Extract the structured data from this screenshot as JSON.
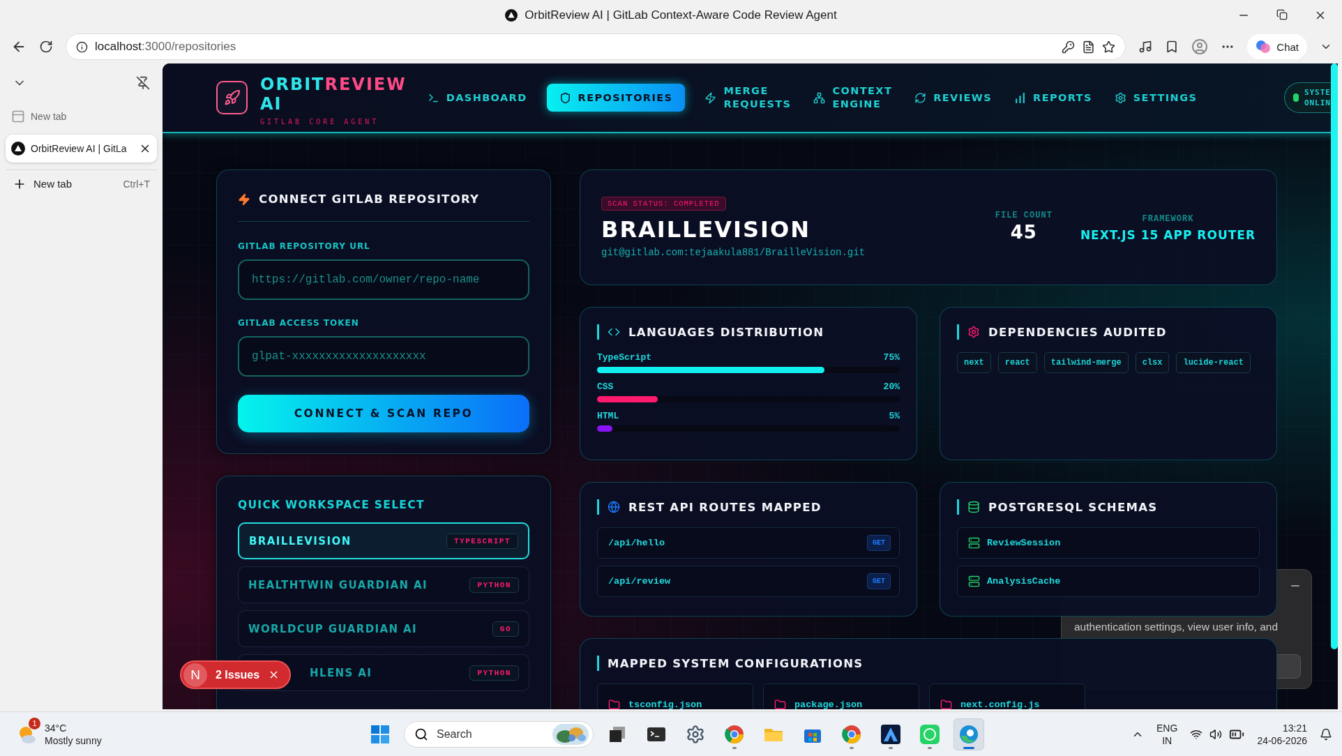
{
  "browser": {
    "window_title": "OrbitReview AI | GitLab Context-Aware Code Review Agent",
    "url_host": "localhost",
    "url_path": ":3000/repositories",
    "chat_label": "Chat"
  },
  "vertical_tabs": {
    "tabs": [
      {
        "title": "New tab",
        "selected": false
      },
      {
        "title": "OrbitReview AI | GitLa",
        "selected": true
      }
    ],
    "new_tab": {
      "label": "New tab",
      "shortcut": "Ctrl+T"
    }
  },
  "brand": {
    "name_words": [
      [
        {
          "text": "ORBIT",
          "color": "#2ee6ea"
        },
        {
          "text": "REVIEW",
          "color": "#ff4a86"
        }
      ],
      [
        {
          "text": "AI",
          "color": "#2ee6ea"
        }
      ]
    ],
    "subtitle": "GITLAB CORE AGENT"
  },
  "nav": [
    {
      "label": "DASHBOARD",
      "selected": false
    },
    {
      "label": "REPOSITORIES",
      "selected": true
    },
    {
      "label": "MERGE REQUESTS",
      "selected": false
    },
    {
      "label": "CONTEXT ENGINE",
      "selected": false
    },
    {
      "label": "REVIEWS",
      "selected": false
    },
    {
      "label": "REPORTS",
      "selected": false
    },
    {
      "label": "SETTINGS",
      "selected": false
    }
  ],
  "system_status": {
    "label": "SYSTE ONLIN",
    "online": true
  },
  "connect_card": {
    "title": "CONNECT GITLAB REPOSITORY",
    "fields": [
      {
        "label": "GITLAB REPOSITORY URL",
        "placeholder": "https://gitlab.com/owner/repo-name"
      },
      {
        "label": "GITLAB ACCESS TOKEN",
        "placeholder": "glpat-xxxxxxxxxxxxxxxxxxxx"
      }
    ],
    "button": "CONNECT & SCAN REPO"
  },
  "workspace_card": {
    "title": "QUICK WORKSPACE SELECT",
    "items": [
      {
        "name": "BRAILLEVISION",
        "language": "TYPESCRIPT",
        "selected": true,
        "obscured": false
      },
      {
        "name": "HEALTHTWIN GUARDIAN AI",
        "language": "PYTHON",
        "selected": false,
        "obscured": false
      },
      {
        "name": "WORLDCUP GUARDIAN AI",
        "language": "GO",
        "selected": false,
        "obscured": false
      },
      {
        "name": "HLENS AI",
        "language": "PYTHON",
        "selected": false,
        "obscured": true
      }
    ]
  },
  "repo_summary": {
    "status": "SCAN STATUS: COMPLETED",
    "name": "BRAILLEVISION",
    "git_url": "git@gitlab.com:tejaakula881/BrailleVision.git",
    "stats": [
      {
        "label": "FILE COUNT",
        "value": "45",
        "kind": "number"
      },
      {
        "label": "FRAMEWORK",
        "value": "NEXT.JS 15 APP ROUTER",
        "kind": "text"
      }
    ]
  },
  "languages": {
    "title": "LANGUAGES DISTRIBUTION",
    "items": [
      {
        "name": "TypeScript",
        "percent": "75%",
        "level": 0.75,
        "color": "#12f0f0"
      },
      {
        "name": "CSS",
        "percent": "20%",
        "level": 0.2,
        "color": "#ff1a6e"
      },
      {
        "name": "HTML",
        "percent": "5%",
        "level": 0.05,
        "color": "#8a12f5"
      }
    ]
  },
  "dependencies": {
    "title": "DEPENDENCIES AUDITED",
    "items": [
      "next",
      "react",
      "tailwind-merge",
      "clsx",
      "lucide-react"
    ]
  },
  "api_routes": {
    "title": "REST API ROUTES MAPPED",
    "items": [
      {
        "path": "/api/hello",
        "method": "GET"
      },
      {
        "path": "/api/review",
        "method": "GET"
      }
    ]
  },
  "schemas": {
    "title": "POSTGRESQL SCHEMAS",
    "items": [
      "ReviewSession",
      "AnalysisCache"
    ]
  },
  "configs": {
    "title": "MAPPED SYSTEM CONFIGURATIONS",
    "items": [
      "tsconfig.json",
      "package.json",
      "next.config.js"
    ]
  },
  "popup": {
    "text": "authentication settings, view user info, and"
  },
  "issues_badge": {
    "letter": "N",
    "label": "2 Issues"
  },
  "taskbar": {
    "weather": {
      "temperature": "34°C",
      "condition": "Mostly sunny",
      "badge": "1"
    },
    "search": {
      "placeholder": "Search"
    },
    "apps": [
      {
        "kind": "start",
        "running": false,
        "selected": false
      },
      {
        "kind": "taskview",
        "running": false,
        "selected": false
      },
      {
        "kind": "terminal",
        "running": false,
        "selected": false
      },
      {
        "kind": "settings",
        "running": false,
        "selected": false
      },
      {
        "kind": "browser",
        "running": true,
        "selected": false
      },
      {
        "kind": "folder",
        "running": false,
        "selected": false
      },
      {
        "kind": "store",
        "running": false,
        "selected": false
      },
      {
        "kind": "browser2",
        "running": true,
        "selected": false
      },
      {
        "kind": "triangle",
        "running": true,
        "selected": false
      },
      {
        "kind": "chat",
        "running": true,
        "selected": false
      },
      {
        "kind": "edge",
        "running": true,
        "selected": true
      }
    ],
    "language": [
      "ENG",
      "IN"
    ],
    "time": "13:21",
    "date": "24-06-2026"
  }
}
